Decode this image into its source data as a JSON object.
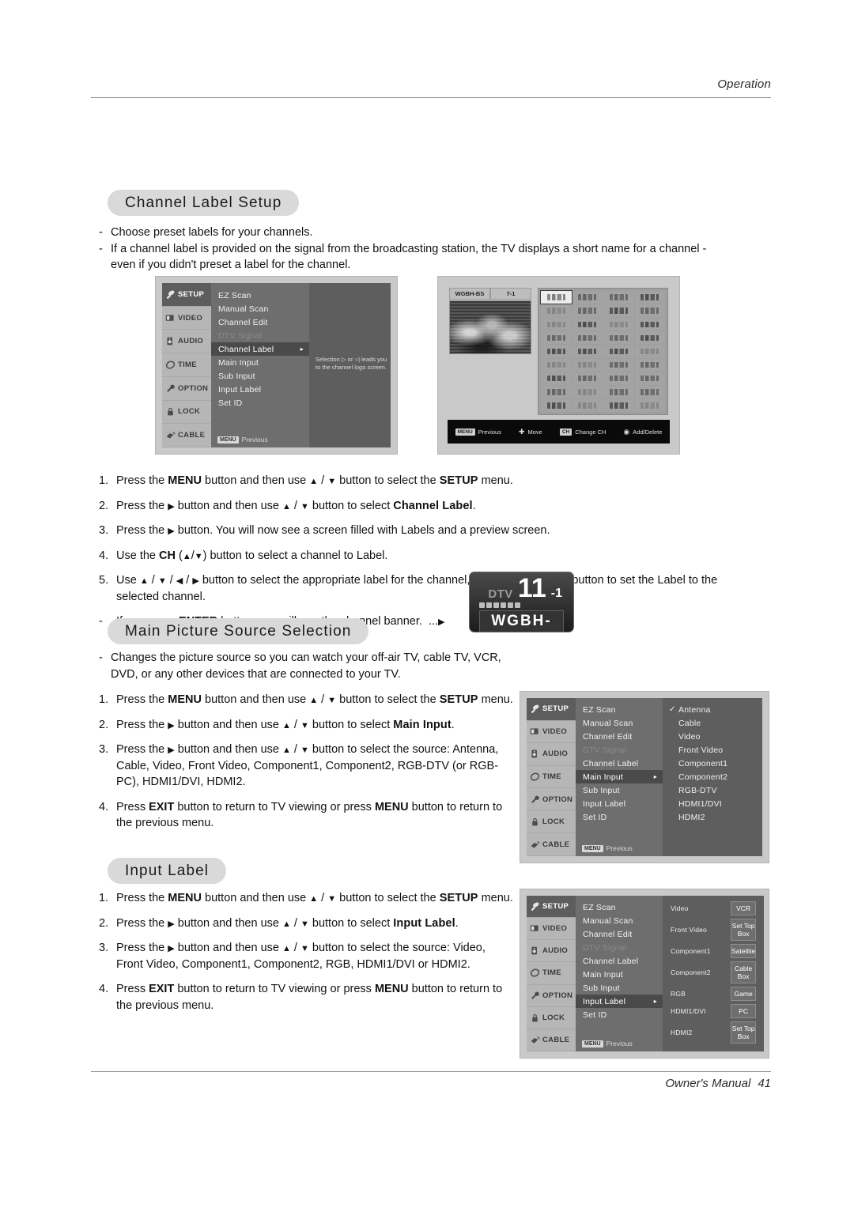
{
  "page": {
    "header_label": "Operation",
    "footer_label": "Owner's Manual",
    "page_number": "41"
  },
  "sections": {
    "channel_label_setup": {
      "title": "Channel Label Setup",
      "bullets": [
        "Choose preset labels for your channels.",
        "If a channel label is provided on the signal from the broadcasting station, the TV displays a short name for a channel - even if you didn't preset a label for the channel."
      ],
      "steps": [
        {
          "num": "1.",
          "text": "Press the MENU button and then use ▲ / ▼ button to select the SETUP menu."
        },
        {
          "num": "2.",
          "text": "Press the ▶ button and then use ▲ / ▼ button to select Channel Label."
        },
        {
          "num": "3.",
          "text": "Press the ▶ button. You will now see a screen filled with Labels and a preview screen."
        },
        {
          "num": "4.",
          "text": "Use the CH (▲/▼) button to select a channel to Label."
        },
        {
          "num": "5.",
          "text": "Use ▲ / ▼ / ◀ / ▶ button to select the appropriate label for the channel, then press ENTER button to set the Label to the selected channel."
        },
        {
          "num": "-",
          "text": "If you press ENTER button, you will see the channel banner.  ...▶"
        }
      ]
    },
    "main_picture_source": {
      "title": "Main Picture Source Selection",
      "bullets": [
        "Changes the picture source so you can watch your off-air TV, cable TV, VCR, DVD, or any other devices that are connected to your TV."
      ],
      "steps": [
        {
          "num": "1.",
          "text": "Press the MENU button and then use ▲ / ▼ button to select the SETUP menu."
        },
        {
          "num": "2.",
          "text": "Press the ▶ button and then use ▲ / ▼ button to select Main Input."
        },
        {
          "num": "3.",
          "text": "Press the ▶ button and then use ▲ / ▼ button to select the source: Antenna, Cable, Video, Front Video, Component1, Component2, RGB-DTV (or RGB-PC), HDMI1/DVI, HDMI2."
        },
        {
          "num": "4.",
          "text": "Press EXIT button to return to TV viewing or press MENU button to return to the previous menu."
        }
      ]
    },
    "input_label": {
      "title": "Input Label",
      "steps": [
        {
          "num": "1.",
          "text": "Press the MENU button and then use ▲ / ▼ button to select the SETUP menu."
        },
        {
          "num": "2.",
          "text": "Press the ▶ button and then use ▲ / ▼ button to select Input Label."
        },
        {
          "num": "3.",
          "text": "Press the ▶ button and then use ▲ / ▼ button to select the source: Video, Front Video, Component1, Component2, RGB, HDMI1/DVI or HDMI2."
        },
        {
          "num": "4.",
          "text": "Press EXIT button to return to TV viewing or press MENU button to return to the previous menu."
        }
      ]
    }
  },
  "osd": {
    "sidebar": [
      {
        "label": "SETUP",
        "icon": "satellite-dish-icon"
      },
      {
        "label": "VIDEO",
        "icon": "monitor-icon"
      },
      {
        "label": "AUDIO",
        "icon": "speaker-icon"
      },
      {
        "label": "TIME",
        "icon": "clock-icon"
      },
      {
        "label": "OPTION",
        "icon": "wrench-icon"
      },
      {
        "label": "LOCK",
        "icon": "padlock-icon"
      },
      {
        "label": "CABLE",
        "icon": "cable-plug-icon"
      }
    ],
    "menu_items": [
      "EZ Scan",
      "Manual Scan",
      "Channel Edit",
      "DTV Signal",
      "Channel Label",
      "Main Input",
      "Sub Input",
      "Input Label",
      "Set ID"
    ],
    "previous_key": "MENU",
    "previous_label": "Previous",
    "channel_label_tip": "Selection ▷ or ○| leads you to the channel logo screen.",
    "main_input_options": [
      "Antenna",
      "Cable",
      "Video",
      "Front Video",
      "Component1",
      "Component2",
      "RGB-DTV",
      "HDMI1/DVI",
      "HDMI2"
    ],
    "main_input_selected": "Antenna",
    "input_label_rows": [
      {
        "source": "Video",
        "value": "VCR"
      },
      {
        "source": "Front Video",
        "value": "Set Top Box"
      },
      {
        "source": "Component1",
        "value": "Satellite"
      },
      {
        "source": "Component2",
        "value": "Cable Box"
      },
      {
        "source": "RGB",
        "value": "Game"
      },
      {
        "source": "HDMI1/DVI",
        "value": "PC"
      },
      {
        "source": "HDMI2",
        "value": "Set Top Box"
      }
    ]
  },
  "logo_screen": {
    "callsign": "WGBH-BS",
    "channel": "7-1",
    "bottom_bar": [
      {
        "key": "MENU",
        "label": "Previous"
      },
      {
        "key": "",
        "label": "Move"
      },
      {
        "key": "CH",
        "label": "Change CH"
      },
      {
        "key": "",
        "label": "Add/Delete"
      }
    ]
  },
  "channel_banner": {
    "source": "DTV",
    "channel_major": "11",
    "channel_minor": "-1",
    "callsign": "WGBH-BS"
  }
}
